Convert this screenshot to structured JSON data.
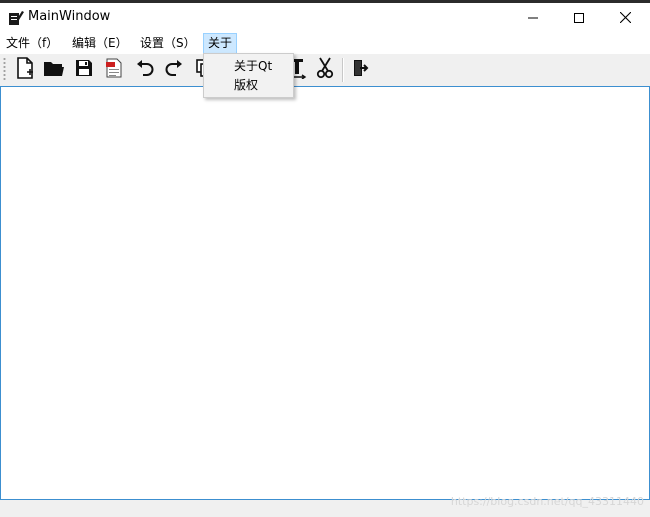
{
  "window": {
    "title": "MainWindow",
    "app_icon": "notepad-pen-icon"
  },
  "window_controls": {
    "minimize": "minimize-icon",
    "maximize": "maximize-icon",
    "close": "close-icon"
  },
  "menubar": {
    "items": [
      {
        "label": "文件（f）"
      },
      {
        "label": "编辑（E）"
      },
      {
        "label": "设置（S）"
      },
      {
        "label": "关于"
      }
    ],
    "active_index": 3
  },
  "dropdown": {
    "items": [
      {
        "label": "关于Qt"
      },
      {
        "label": "版权"
      }
    ]
  },
  "toolbar": {
    "buttons": [
      {
        "icon": "new-file-icon"
      },
      {
        "icon": "open-folder-icon"
      },
      {
        "icon": "save-icon"
      },
      {
        "icon": "pdf-export-icon"
      },
      {
        "icon": "undo-icon"
      },
      {
        "icon": "redo-icon"
      },
      {
        "icon": "copy-icon"
      },
      {
        "icon": "text-format-icon"
      },
      {
        "icon": "cut-icon"
      },
      {
        "icon": "exit-icon"
      }
    ]
  },
  "colors": {
    "accent": "#3c8fd0",
    "menu_highlight": "#cde8ff",
    "pdf_red": "#cc2020"
  },
  "watermark": "https://blog.csdn.net/qq_43311440"
}
